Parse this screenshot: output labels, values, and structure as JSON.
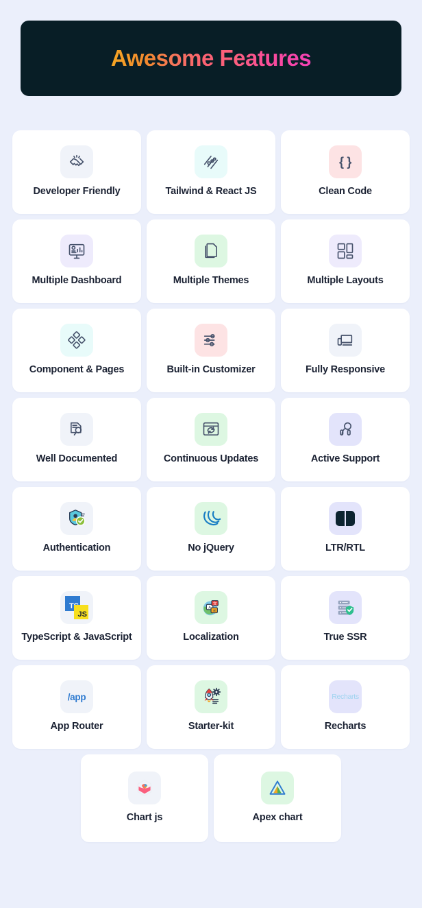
{
  "header": {
    "title": "Awesome Features",
    "gradient_from": "#f5a623",
    "gradient_to": "#f442b5",
    "background": "#081e26"
  },
  "theme": {
    "page_background": "#ebeffb",
    "card_background": "#ffffff",
    "label_color": "#1b2233"
  },
  "rows": [
    {
      "cards": [
        {
          "label": "Developer Friendly",
          "icon": "handshake-icon",
          "tint": "#f0f3f9"
        },
        {
          "label": "Tailwind & React JS",
          "icon": "sliders-diagonal-icon",
          "tint": "#e8fbfa"
        },
        {
          "label": "Clean Code",
          "icon": "curly-braces-icon",
          "tint": "#fde3e4"
        }
      ]
    },
    {
      "cards": [
        {
          "label": "Multiple Dashboard",
          "icon": "monitor-analytics-icon",
          "tint": "#eeebfc"
        },
        {
          "label": "Multiple Themes",
          "icon": "stacked-pages-icon",
          "tint": "#ddf7e2"
        },
        {
          "label": "Multiple Layouts",
          "icon": "layout-grid-icon",
          "tint": "#eeebfc"
        }
      ]
    },
    {
      "cards": [
        {
          "label": "Component & Pages",
          "icon": "diamond-cluster-icon",
          "tint": "#e8fbfa"
        },
        {
          "label": "Built-in Customizer",
          "icon": "settings-sliders-icon",
          "tint": "#fde3e4"
        },
        {
          "label": "Fully Responsive",
          "icon": "devices-icon",
          "tint": "#f0f3f9"
        }
      ]
    },
    {
      "cards": [
        {
          "label": "Well Documented",
          "icon": "document-search-icon",
          "tint": "#f0f3f9"
        },
        {
          "label": "Continuous Updates",
          "icon": "browser-refresh-icon",
          "tint": "#ddf7e2"
        },
        {
          "label": "Active Support",
          "icon": "headset-icon",
          "tint": "#e3e4fb"
        }
      ]
    },
    {
      "cards": [
        {
          "label": "Authentication",
          "icon": "shield-user-check-icon",
          "tint": "#f0f3f9"
        },
        {
          "label": "No jQuery",
          "icon": "jquery-logo-icon",
          "tint": "#ddf7e2"
        },
        {
          "label": "LTR/RTL",
          "icon": "ltr-rtl-split-icon",
          "tint": "#e3e4fb"
        }
      ]
    },
    {
      "cards": [
        {
          "label": "TypeScript & JavaScript",
          "icon": "typescript-javascript-icon",
          "tint": "#f0f3f9"
        },
        {
          "label": "Localization",
          "icon": "globe-translate-icon",
          "tint": "#ddf7e2"
        },
        {
          "label": "True SSR",
          "icon": "server-shield-icon",
          "tint": "#e3e4fb"
        }
      ]
    },
    {
      "cards": [
        {
          "label": "App Router",
          "icon": "app-route-text-icon",
          "tint": "#f0f3f9",
          "glyph_text": "/app"
        },
        {
          "label": "Starter-kit",
          "icon": "rocket-gear-icon",
          "tint": "#ddf7e2"
        },
        {
          "label": "Recharts",
          "icon": "recharts-text-icon",
          "tint": "#e3e4fb",
          "glyph_text": "Recharts"
        }
      ]
    },
    {
      "centered": true,
      "cards": [
        {
          "label": "Chart js",
          "icon": "chartjs-logo-icon",
          "tint": "#f0f3f9"
        },
        {
          "label": "Apex chart",
          "icon": "apexcharts-logo-icon",
          "tint": "#ddf7e2"
        }
      ]
    }
  ]
}
